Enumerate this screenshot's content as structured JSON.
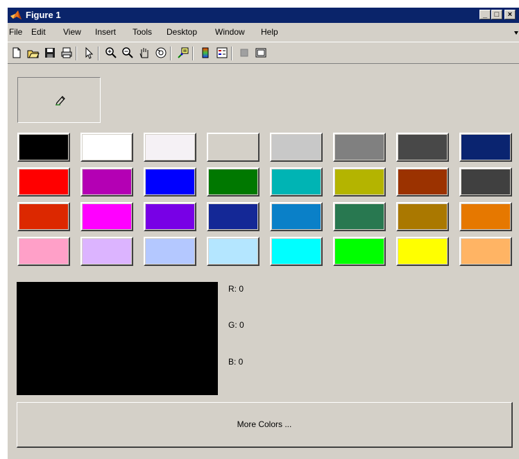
{
  "window": {
    "title": "Figure 1"
  },
  "title_buttons": {
    "minimize": "_",
    "maximize": "□",
    "close": "×"
  },
  "menu": [
    "File",
    "Edit",
    "View",
    "Insert",
    "Tools",
    "Desktop",
    "Window",
    "Help"
  ],
  "toolbar": [
    {
      "icon": "new-file-icon",
      "sep_after": false
    },
    {
      "icon": "open-folder-icon",
      "sep_after": false
    },
    {
      "icon": "save-icon",
      "sep_after": false
    },
    {
      "icon": "print-icon",
      "sep_after": true
    },
    {
      "icon": "pointer-icon",
      "sep_after": true
    },
    {
      "icon": "zoom-in-icon",
      "sep_after": false
    },
    {
      "icon": "zoom-out-icon",
      "sep_after": false
    },
    {
      "icon": "pan-hand-icon",
      "sep_after": false
    },
    {
      "icon": "rotate-3d-icon",
      "sep_after": true
    },
    {
      "icon": "data-cursor-icon",
      "sep_after": true
    },
    {
      "icon": "colorbar-icon",
      "sep_after": false
    },
    {
      "icon": "legend-icon",
      "sep_after": true
    },
    {
      "icon": "hide-plot-tools-icon",
      "sep_after": false
    },
    {
      "icon": "show-plot-tools-icon",
      "sep_after": false
    }
  ],
  "palette": [
    [
      "#000000",
      "#ffffff",
      "#f5f1f5",
      "#d4d0c8",
      "#c8c8c8",
      "#808080",
      "#484848",
      "#0a2470"
    ],
    [
      "#ff0000",
      "#b400b4",
      "#0000ff",
      "#007800",
      "#00b4b4",
      "#b4b400",
      "#9b3200",
      "#404040"
    ],
    [
      "#dc2800",
      "#ff00ff",
      "#7800e6",
      "#142896",
      "#0a80c8",
      "#287850",
      "#aa7800",
      "#e67800"
    ],
    [
      "#ffa0c8",
      "#dcb4ff",
      "#b4c8ff",
      "#b4e6ff",
      "#00ffff",
      "#00ff00",
      "#ffff00",
      "#ffb464"
    ]
  ],
  "preview": {
    "color": "#000000",
    "r": "R: 0",
    "g": "G: 0",
    "b": "B: 0"
  },
  "more_button": "More Colors ..."
}
